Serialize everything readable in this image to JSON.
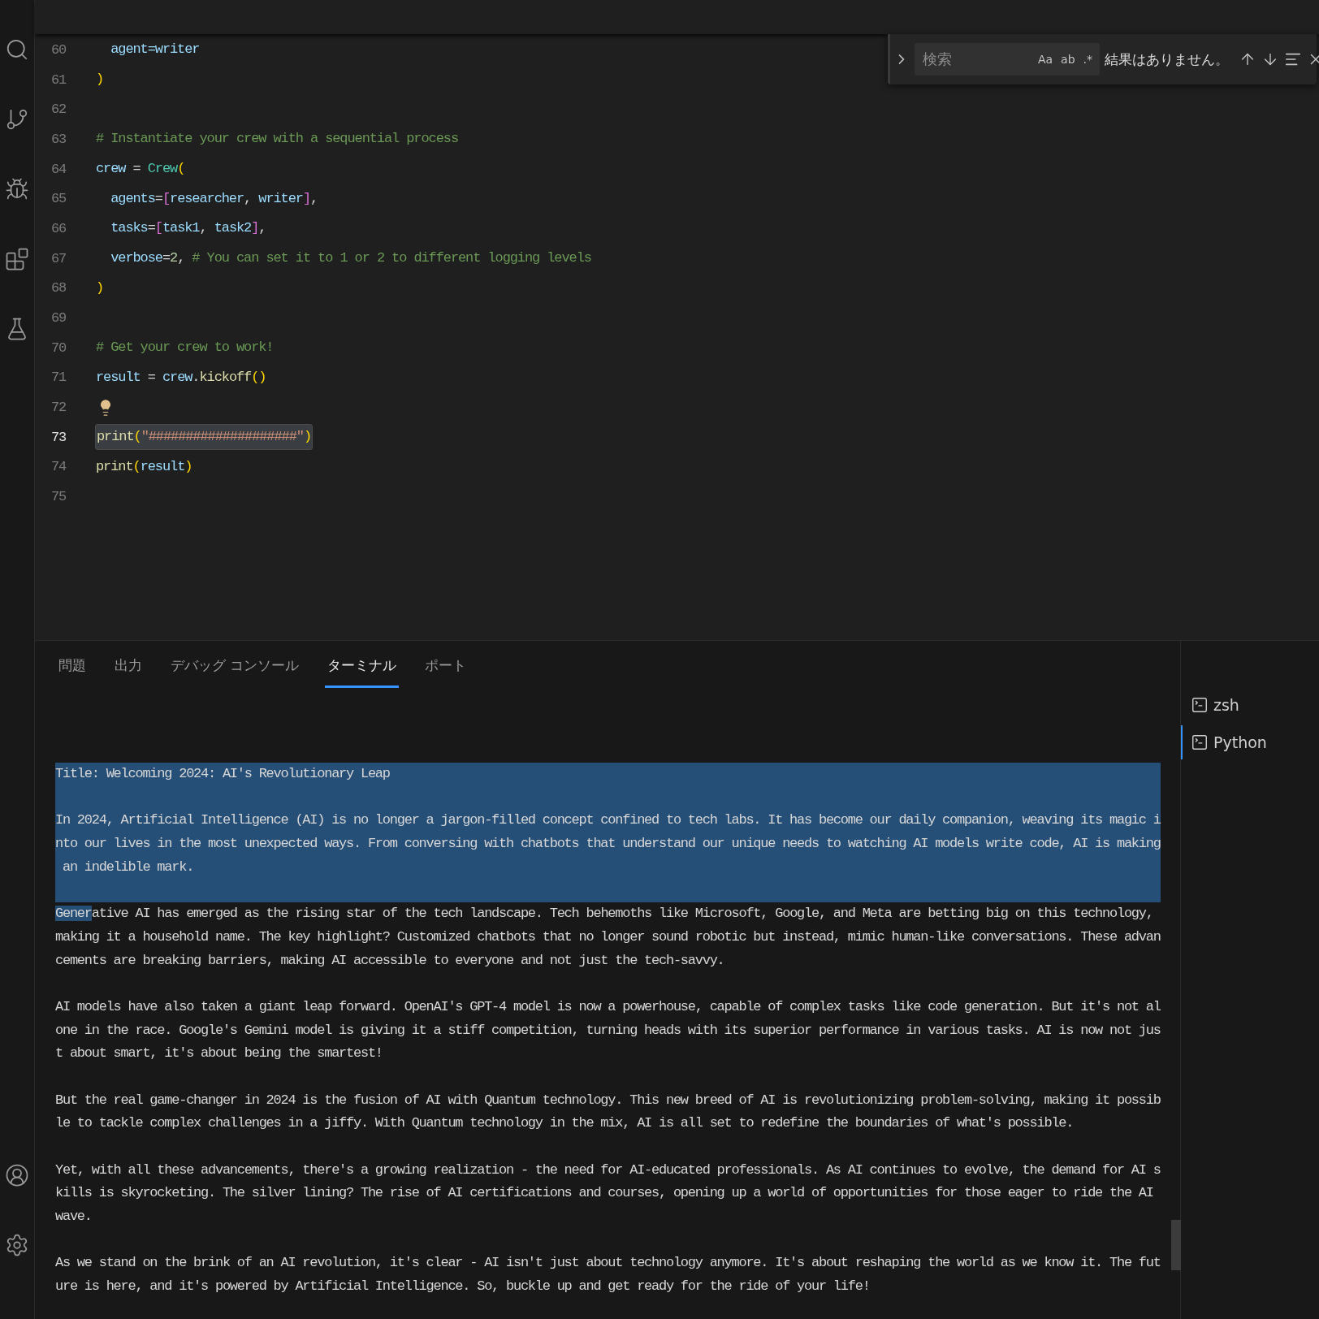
{
  "activity_bar": {
    "items": [
      {
        "kind": "search",
        "selected": false
      },
      {
        "kind": "source-control",
        "selected": false
      },
      {
        "kind": "run-debug",
        "selected": false
      },
      {
        "kind": "extensions",
        "selected": false
      },
      {
        "kind": "testing",
        "selected": false
      },
      {
        "kind": "account",
        "selected": false
      },
      {
        "kind": "settings",
        "selected": false
      }
    ]
  },
  "find_widget": {
    "placeholder": "検索",
    "options": [
      "Aa",
      "ab",
      ".*"
    ],
    "result": "結果はありません。"
  },
  "editor": {
    "lines": [
      {
        "number": "60",
        "current": false,
        "kind": "code",
        "tokens": [
          {
            "text": "  agent=writer",
            "kind": "var"
          }
        ]
      },
      {
        "number": "61",
        "current": false,
        "kind": "code",
        "tokens": [
          {
            "text": ")",
            "kind": "bracket"
          }
        ]
      },
      {
        "number": "62",
        "current": false,
        "kind": "blank"
      },
      {
        "number": "63",
        "current": false,
        "kind": "code",
        "tokens": [
          {
            "text": "# Instantiate your crew with a sequential process",
            "kind": "comment"
          }
        ]
      },
      {
        "number": "64",
        "current": false,
        "kind": "code",
        "tokens": [
          {
            "text": "crew",
            "kind": "var"
          },
          {
            "text": " = ",
            "kind": "punct"
          },
          {
            "text": "Crew",
            "kind": "class"
          },
          {
            "text": "(",
            "kind": "bracket"
          }
        ]
      },
      {
        "number": "65",
        "current": false,
        "kind": "code",
        "tokens": [
          {
            "text": "  agents",
            "kind": "var"
          },
          {
            "text": "=",
            "kind": "punct"
          },
          {
            "text": "[",
            "kind": "bracket2"
          },
          {
            "text": "researcher",
            "kind": "var"
          },
          {
            "text": ", ",
            "kind": "punct"
          },
          {
            "text": "writer",
            "kind": "var"
          },
          {
            "text": "]",
            "kind": "bracket2"
          },
          {
            "text": ",",
            "kind": "punct"
          }
        ]
      },
      {
        "number": "66",
        "current": false,
        "kind": "code",
        "tokens": [
          {
            "text": "  tasks",
            "kind": "var"
          },
          {
            "text": "=",
            "kind": "punct"
          },
          {
            "text": "[",
            "kind": "bracket2"
          },
          {
            "text": "task1",
            "kind": "var"
          },
          {
            "text": ", ",
            "kind": "punct"
          },
          {
            "text": "task2",
            "kind": "var"
          },
          {
            "text": "]",
            "kind": "bracket2"
          },
          {
            "text": ",",
            "kind": "punct"
          }
        ]
      },
      {
        "number": "67",
        "current": false,
        "kind": "code",
        "tokens": [
          {
            "text": "  verbose",
            "kind": "var"
          },
          {
            "text": "=",
            "kind": "punct"
          },
          {
            "text": "2",
            "kind": "number"
          },
          {
            "text": ", ",
            "kind": "punct"
          },
          {
            "text": "# You can set it to 1 or 2 to different logging levels",
            "kind": "comment"
          }
        ]
      },
      {
        "number": "68",
        "current": false,
        "kind": "code",
        "tokens": [
          {
            "text": ")",
            "kind": "bracket"
          }
        ]
      },
      {
        "number": "69",
        "current": false,
        "kind": "blank"
      },
      {
        "number": "70",
        "current": false,
        "kind": "code",
        "tokens": [
          {
            "text": "# Get your crew to work!",
            "kind": "comment"
          }
        ]
      },
      {
        "number": "71",
        "current": false,
        "kind": "code",
        "tokens": [
          {
            "text": "result",
            "kind": "var"
          },
          {
            "text": " = ",
            "kind": "punct"
          },
          {
            "text": "crew",
            "kind": "var"
          },
          {
            "text": ".",
            "kind": "punct"
          },
          {
            "text": "kickoff",
            "kind": "func"
          },
          {
            "text": "()",
            "kind": "bracket"
          }
        ]
      },
      {
        "number": "72",
        "current": false,
        "kind": "lightbulb"
      },
      {
        "number": "73",
        "current": true,
        "kind": "highlighted",
        "tokens": [
          {
            "text": "print",
            "kind": "func"
          },
          {
            "text": "(",
            "kind": "bracket"
          },
          {
            "text": "\"####################\"",
            "kind": "string"
          },
          {
            "text": ")",
            "kind": "bracket"
          }
        ]
      },
      {
        "number": "74",
        "current": false,
        "kind": "code",
        "tokens": [
          {
            "text": "print",
            "kind": "func"
          },
          {
            "text": "(",
            "kind": "bracket"
          },
          {
            "text": "result",
            "kind": "var"
          },
          {
            "text": ")",
            "kind": "bracket"
          }
        ]
      },
      {
        "number": "75",
        "current": false,
        "kind": "blank"
      }
    ]
  },
  "panel": {
    "tabs": [
      {
        "label": "問題",
        "selected": false
      },
      {
        "label": "出力",
        "selected": false
      },
      {
        "label": "デバッグ コンソール",
        "selected": false
      },
      {
        "label": "ターミナル",
        "selected": true
      },
      {
        "label": "ポート",
        "selected": false
      }
    ],
    "terminals": [
      {
        "label": "zsh",
        "selected": false
      },
      {
        "label": "Python",
        "selected": true
      }
    ],
    "lines": [
      {
        "kind": "text",
        "segments": [
          {
            "text": "Title: Welcoming 2024: AI's Revolutionary Leap",
            "selected": true
          }
        ]
      },
      {
        "kind": "blank",
        "selected": true
      },
      {
        "kind": "text",
        "segments": [
          {
            "text": "In 2024, Artificial Intelligence (AI) is no longer a jargon-filled concept confined to tech labs. It has become our daily companion, weaving its magic i",
            "selected": true
          }
        ]
      },
      {
        "kind": "text",
        "segments": [
          {
            "text": "nto our lives in the most unexpected ways. From conversing with chatbots that understand our unique needs to watching AI models write code, AI is making",
            "selected": true
          }
        ]
      },
      {
        "kind": "text",
        "segments": [
          {
            "text": " an indelible mark.",
            "selected": true
          }
        ]
      },
      {
        "kind": "blank",
        "selected": true
      },
      {
        "kind": "text",
        "segments": [
          {
            "text": "Gener",
            "selected": true
          },
          {
            "text": "ative AI has emerged as the rising star of the tech landscape. Tech behemoths like Microsoft, Google, and Meta are betting big on this technology,",
            "selected": false
          }
        ]
      },
      {
        "kind": "text",
        "segments": [
          {
            "text": "making it a household name. The key highlight? Customized chatbots that no longer sound robotic but instead, mimic human-like conversations. These advan",
            "selected": false
          }
        ]
      },
      {
        "kind": "text",
        "segments": [
          {
            "text": "cements are breaking barriers, making AI accessible to everyone and not just the tech-savvy.",
            "selected": false
          }
        ]
      },
      {
        "kind": "blank",
        "selected": false
      },
      {
        "kind": "text",
        "segments": [
          {
            "text": "AI models have also taken a giant leap forward. OpenAI's GPT-4 model is now a powerhouse, capable of complex tasks like code generation. But it's not al",
            "selected": false
          }
        ]
      },
      {
        "kind": "text",
        "segments": [
          {
            "text": "one in the race. Google's Gemini model is giving it a stiff competition, turning heads with its superior performance in various tasks. AI is now not jus",
            "selected": false
          }
        ]
      },
      {
        "kind": "text",
        "segments": [
          {
            "text": "t about smart, it's about being the smartest!",
            "selected": false
          }
        ]
      },
      {
        "kind": "blank",
        "selected": false
      },
      {
        "kind": "text",
        "segments": [
          {
            "text": "But the real game-changer in 2024 is the fusion of AI with Quantum technology. This new breed of AI is revolutionizing problem-solving, making it possib",
            "selected": false
          }
        ]
      },
      {
        "kind": "text",
        "segments": [
          {
            "text": "le to tackle complex challenges in a jiffy. With Quantum technology in the mix, AI is all set to redefine the boundaries of what's possible.",
            "selected": false
          }
        ]
      },
      {
        "kind": "blank",
        "selected": false
      },
      {
        "kind": "text",
        "segments": [
          {
            "text": "Yet, with all these advancements, there's a growing realization - the need for AI-educated professionals. As AI continues to evolve, the demand for AI s",
            "selected": false
          }
        ]
      },
      {
        "kind": "text",
        "segments": [
          {
            "text": "kills is skyrocketing. The silver lining? The rise of AI certifications and courses, opening up a world of opportunities for those eager to ride the AI",
            "selected": false
          }
        ]
      },
      {
        "kind": "text",
        "segments": [
          {
            "text": "wave.",
            "selected": false
          }
        ]
      },
      {
        "kind": "blank",
        "selected": false
      },
      {
        "kind": "text",
        "segments": [
          {
            "text": "As we stand on the brink of an AI revolution, it's clear - AI isn't just about technology anymore. It's about reshaping the world as we know it. The fut",
            "selected": false
          }
        ]
      },
      {
        "kind": "text",
        "segments": [
          {
            "text": "ure is here, and it's powered by Artificial Intelligence. So, buckle up and get ready for the ride of your life!",
            "selected": false
          }
        ]
      }
    ]
  }
}
